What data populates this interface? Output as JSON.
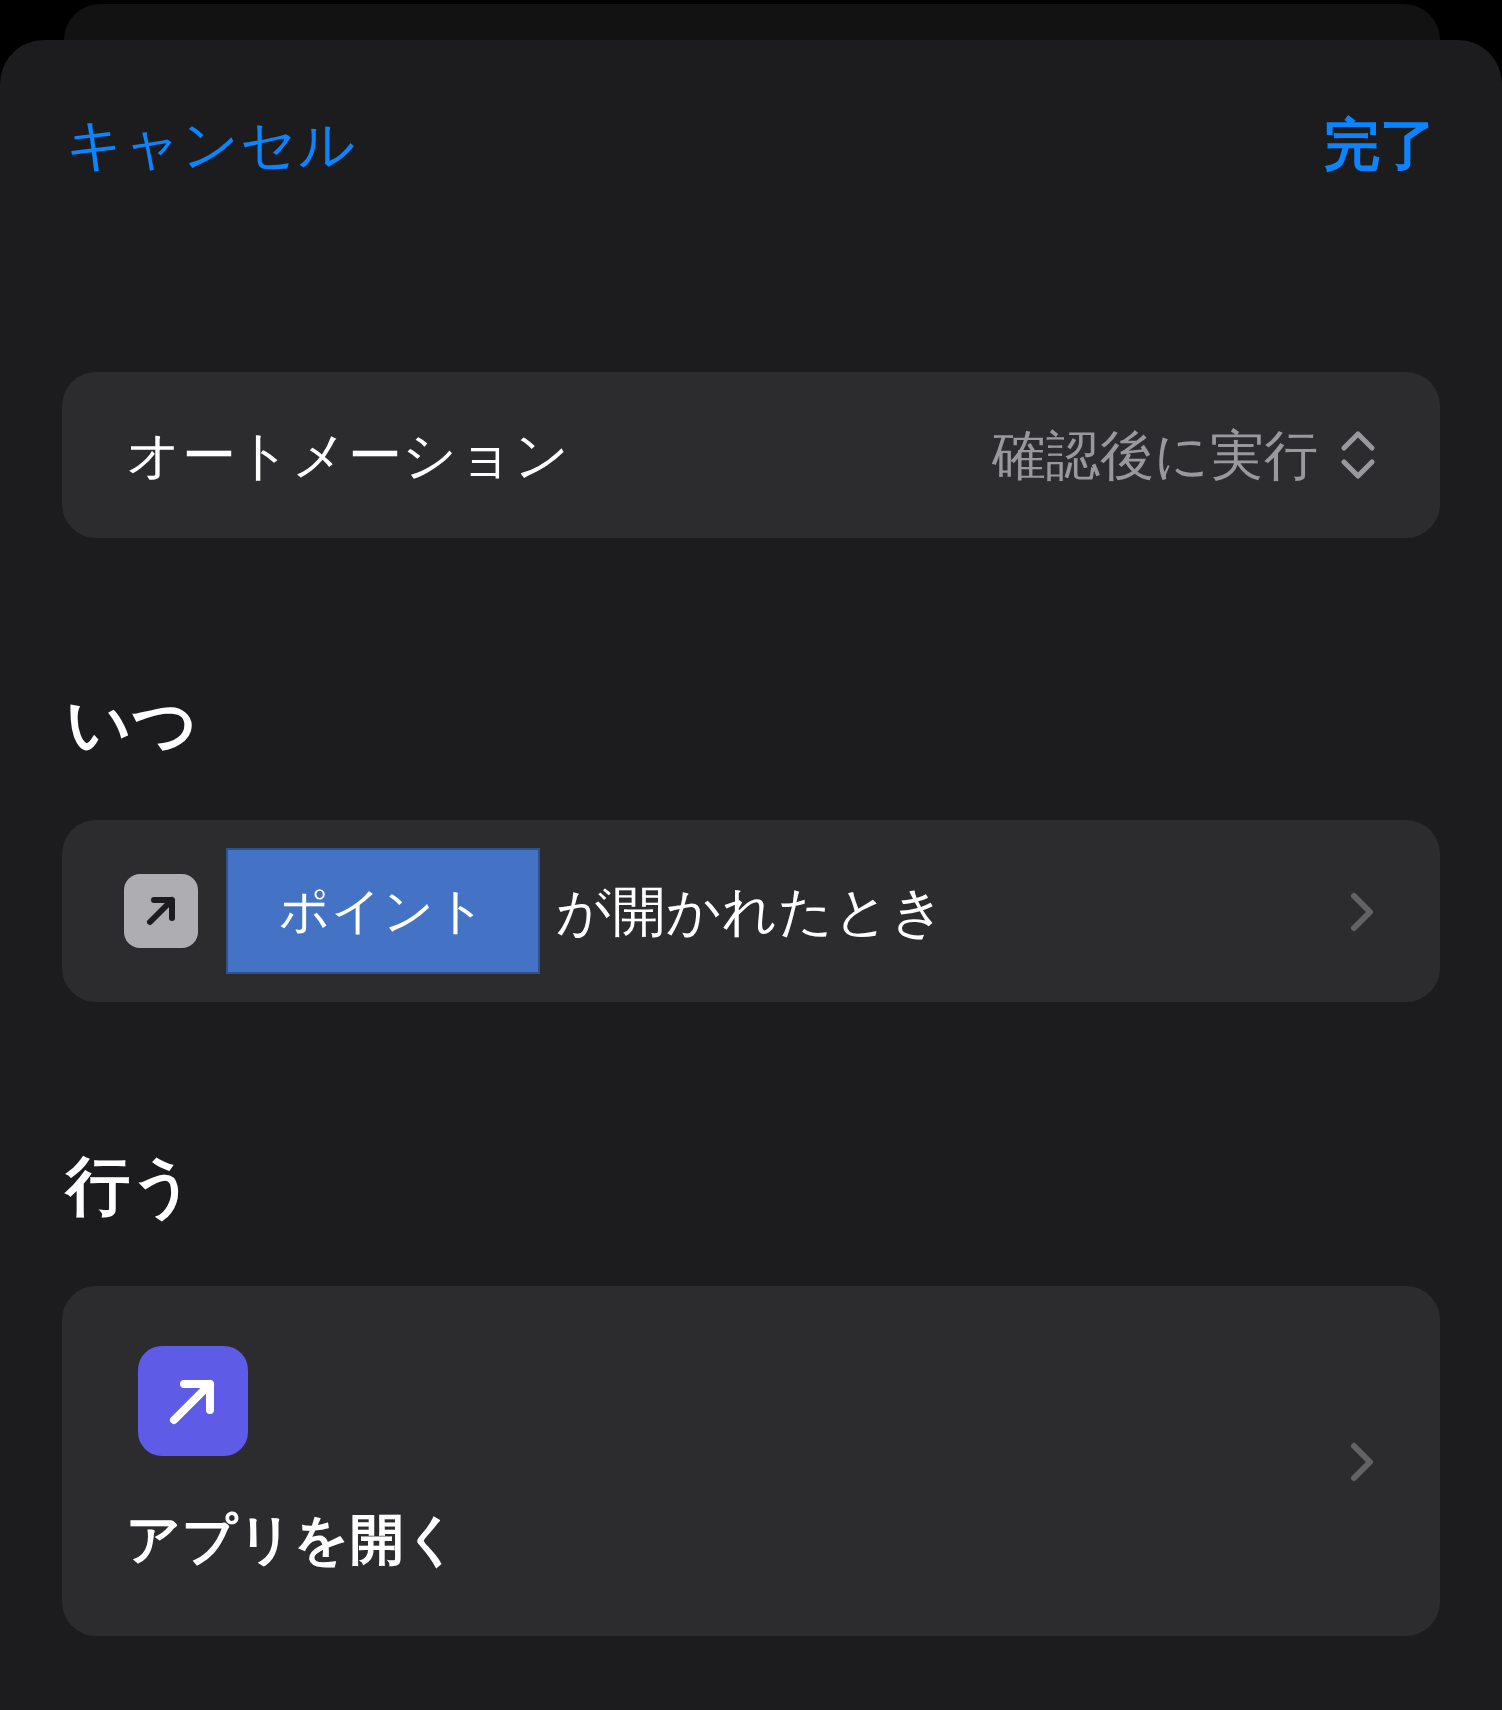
{
  "header": {
    "cancel": "キャンセル",
    "done": "完了"
  },
  "settings": [
    {
      "label": "オートメーション",
      "value": "確認後に実行"
    }
  ],
  "sections": [
    {
      "heading": "いつ",
      "kind": "trigger",
      "app_token": "ポイント",
      "text": "が開かれたとき"
    },
    {
      "heading": "行う",
      "kind": "action",
      "text": "アプリを開く"
    }
  ]
}
